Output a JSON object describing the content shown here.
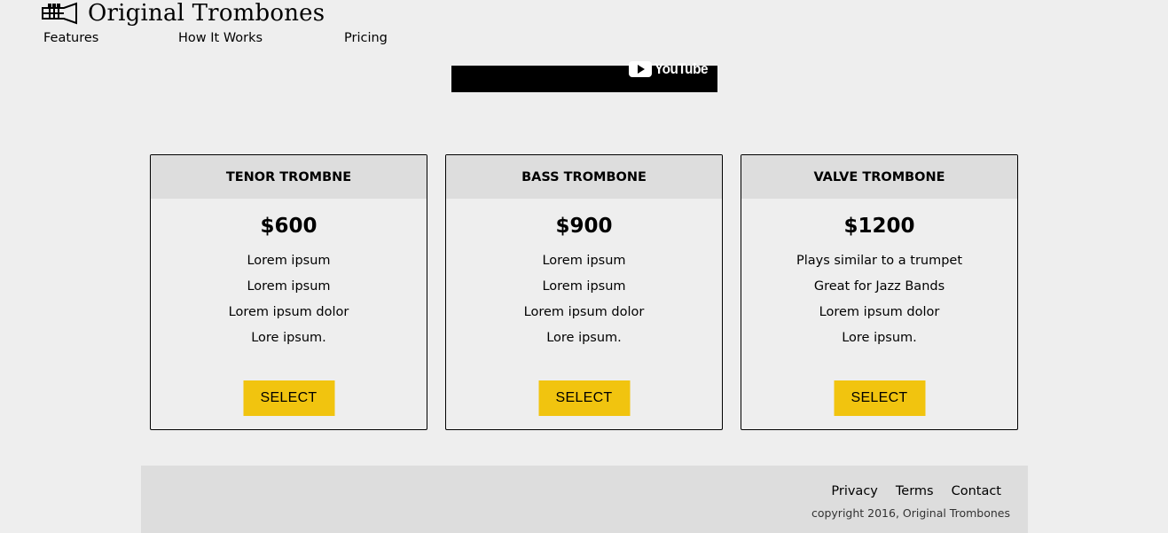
{
  "header": {
    "logo_text": "Original Trombones",
    "nav": [
      {
        "label": "Features"
      },
      {
        "label": "How It Works"
      },
      {
        "label": "Pricing"
      }
    ]
  },
  "video": {
    "brand_text": "YouTube"
  },
  "pricing": {
    "cards": [
      {
        "title": "TENOR TROMBNE",
        "price": "$600",
        "features": [
          "Lorem ipsum",
          "Lorem ipsum",
          "Lorem ipsum dolor",
          "Lore ipsum."
        ],
        "button_label": "SELECT"
      },
      {
        "title": "BASS TROMBONE",
        "price": "$900",
        "features": [
          "Lorem ipsum",
          "Lorem ipsum",
          "Lorem ipsum dolor",
          "Lore ipsum."
        ],
        "button_label": "SELECT"
      },
      {
        "title": "VALVE TROMBONE",
        "price": "$1200",
        "features": [
          "Plays similar to a trumpet",
          "Great for Jazz Bands",
          "Lorem ipsum dolor",
          "Lore ipsum."
        ],
        "button_label": "SELECT"
      }
    ]
  },
  "footer": {
    "links": [
      {
        "label": "Privacy"
      },
      {
        "label": "Terms"
      },
      {
        "label": "Contact"
      }
    ],
    "copyright": "copyright 2016, Original Trombones"
  },
  "colors": {
    "background": "#eeeeee",
    "card_header": "#dddddd",
    "button": "#f1c40f",
    "footer": "#dddddd"
  },
  "icons": {
    "logo": "trumpet-icon",
    "video": "youtube-play-icon"
  }
}
